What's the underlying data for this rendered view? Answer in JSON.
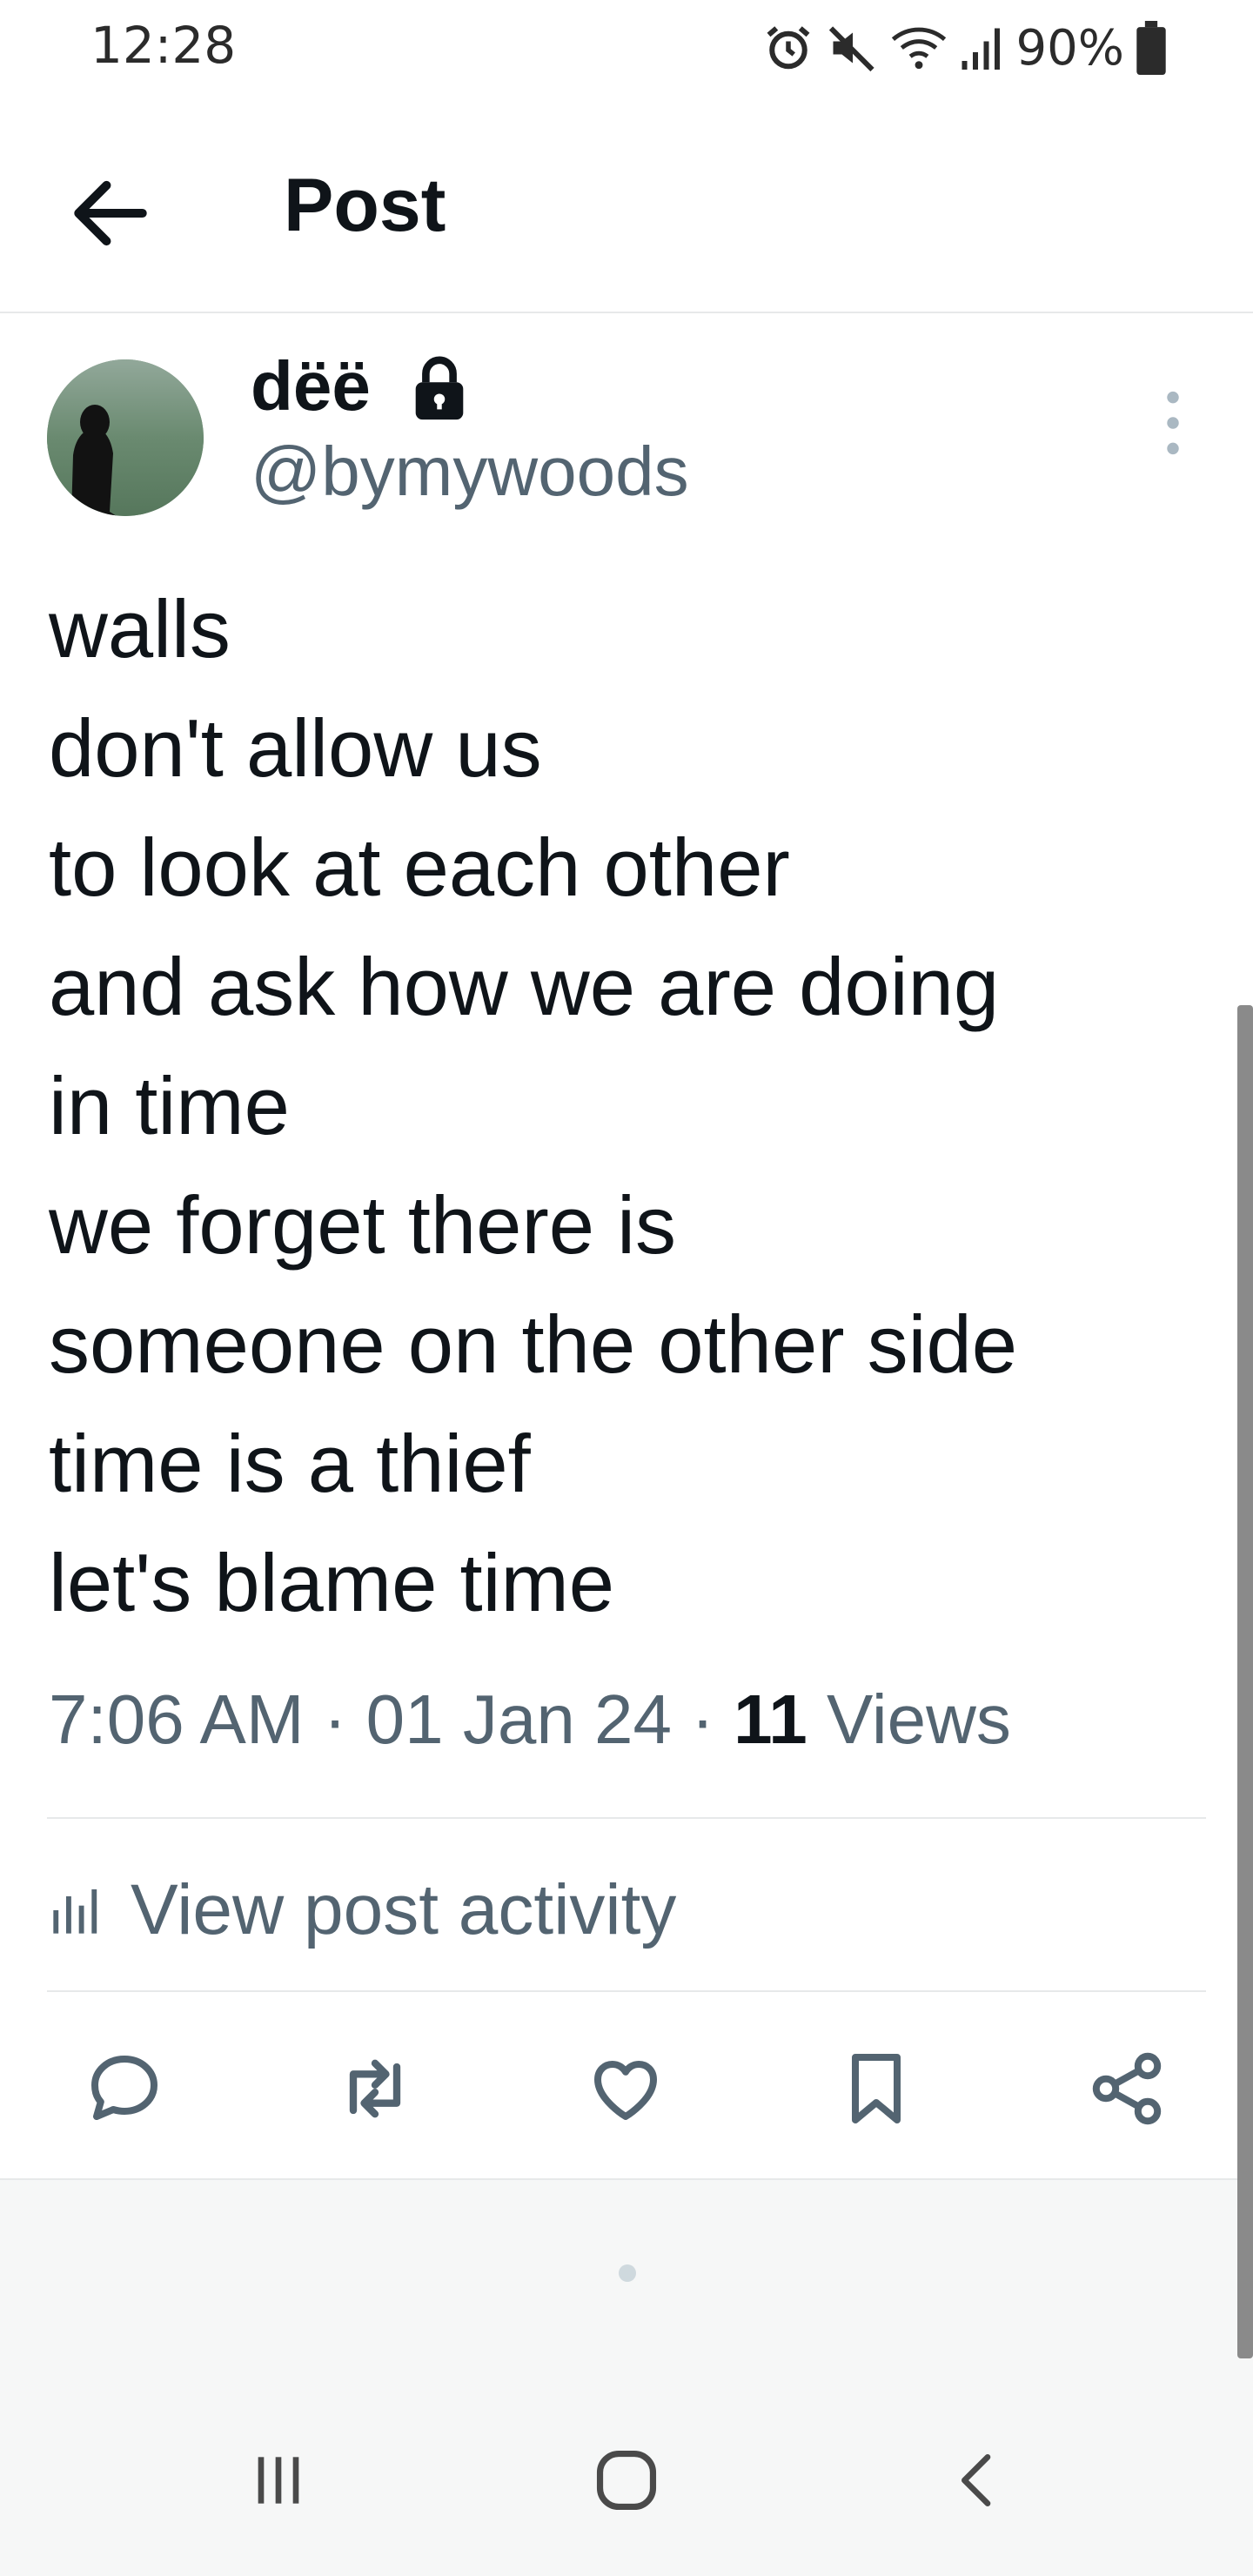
{
  "status_bar": {
    "time": "12:28",
    "battery": "90%",
    "icons": [
      "alarm-icon",
      "mute-icon",
      "wifi-icon",
      "signal-icon",
      "battery-icon"
    ]
  },
  "header": {
    "title": "Post",
    "back_icon": "arrow-left-icon"
  },
  "author": {
    "name": "dëë",
    "handle": "@bymywoods",
    "protected_icon": "lock-icon",
    "more_icon": "more-vertical-icon"
  },
  "post": {
    "lines": [
      "walls",
      "don't allow us",
      "to look at each other",
      "and ask how we are doing",
      "in time",
      "we forget there is",
      "someone on the other side",
      "time is a thief",
      "let's blame time"
    ],
    "time": "7:06 AM",
    "separator": "·",
    "date": "01 Jan 24",
    "views_count": "11",
    "views_label": "Views"
  },
  "activity": {
    "label": "View post activity",
    "icon": "bar-chart-icon"
  },
  "actions": [
    "reply-icon",
    "repost-icon",
    "like-icon",
    "bookmark-icon",
    "share-icon"
  ],
  "nav": [
    "recent-apps-icon",
    "home-icon",
    "back-icon"
  ],
  "colors": {
    "text_primary": "#0f1419",
    "text_secondary": "#536471",
    "divider": "#e7e9ea"
  }
}
